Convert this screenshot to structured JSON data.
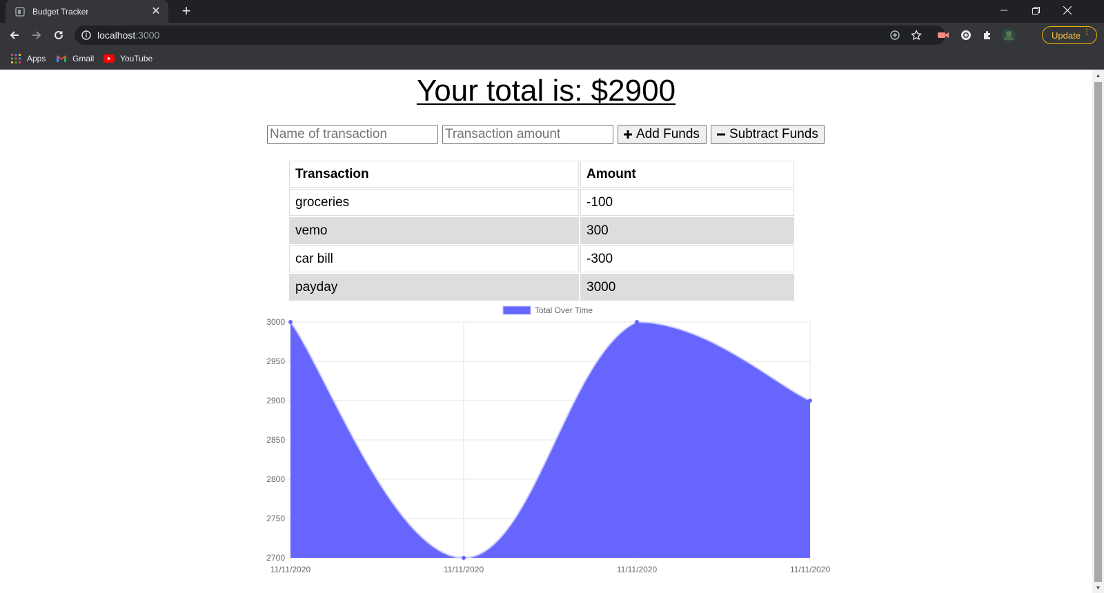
{
  "browser": {
    "tab_title": "Budget Tracker",
    "url_host": "localhost",
    "url_port": ":3000",
    "update_label": "Update",
    "bookmarks": [
      {
        "label": "Apps",
        "icon": "apps-grid-icon"
      },
      {
        "label": "Gmail",
        "icon": "gmail-icon"
      },
      {
        "label": "YouTube",
        "icon": "youtube-icon"
      }
    ]
  },
  "page": {
    "total_label": "Your total is: $",
    "total_value": "2900",
    "name_placeholder": "Name of transaction",
    "amount_placeholder": "Transaction amount",
    "add_label": "Add Funds",
    "subtract_label": "Subtract Funds",
    "table_headers": [
      "Transaction",
      "Amount"
    ],
    "transactions": [
      {
        "name": "groceries",
        "amount": "-100"
      },
      {
        "name": "vemo",
        "amount": "300"
      },
      {
        "name": "car bill",
        "amount": "-300"
      },
      {
        "name": "payday",
        "amount": "3000"
      }
    ]
  },
  "chart_data": {
    "type": "area",
    "legend_position": "top",
    "legend_color": "#6666ff",
    "series": [
      {
        "name": "Total Over Time",
        "values": [
          3000,
          2700,
          3000,
          2900
        ]
      }
    ],
    "x": [
      "11/11/2020",
      "11/11/2020",
      "11/11/2020",
      "11/11/2020"
    ],
    "y_ticks": [
      3000,
      2950,
      2900,
      2850,
      2800,
      2750,
      2700
    ],
    "ylim": [
      2700,
      3000
    ],
    "grid": true,
    "fill_color": "#6666ff"
  }
}
